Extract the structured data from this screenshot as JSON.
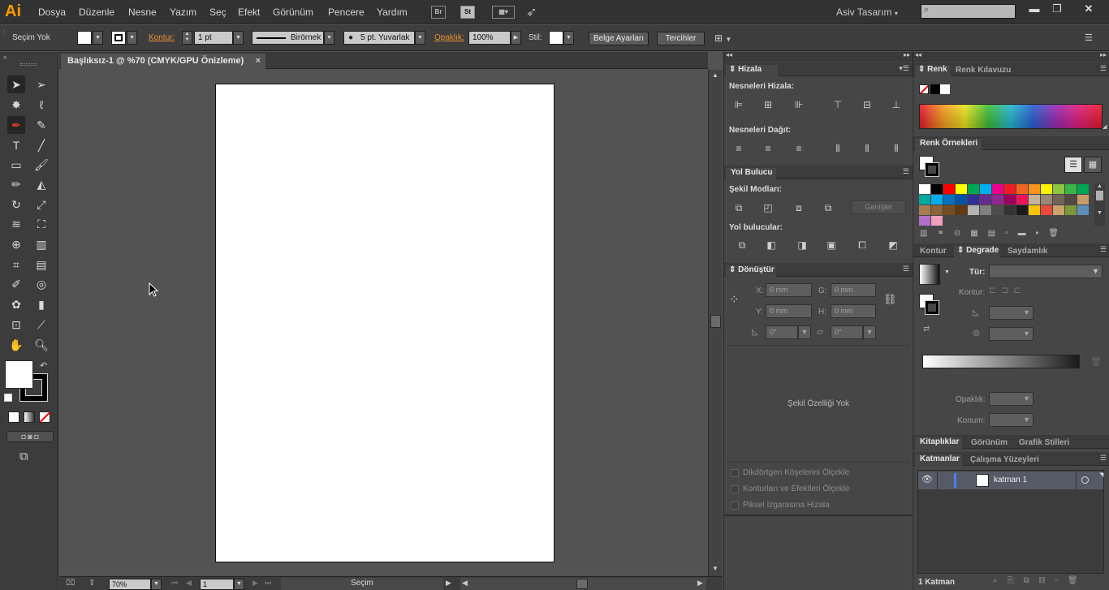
{
  "menubar": {
    "logo": "Ai",
    "items": [
      "Dosya",
      "Düzenle",
      "Nesne",
      "Yazım",
      "Seç",
      "Efekt",
      "Görünüm",
      "Pencere",
      "Yardım"
    ],
    "bridge": "Br",
    "stock": "St",
    "workspace": "Asiv Tasarım",
    "search_placeholder": ""
  },
  "control": {
    "selection": "Seçim Yok",
    "stroke_label": "Kontur:",
    "stroke_weight": "1 pt",
    "profile": "Birörnek",
    "brush": "5 pt. Yuvarlak",
    "opacity_label": "Opaklık:",
    "opacity": "100%",
    "style_label": "Stil:",
    "doc_setup": "Belge Ayarları",
    "prefs": "Tercihler"
  },
  "document": {
    "tab": "Başlıksız-1 @ %70 (CMYK/GPU Önizleme)",
    "close": "×",
    "zoom": "70%",
    "page": "1",
    "status": "Seçim"
  },
  "align": {
    "title": "Hizala",
    "align_objects": "Nesneleri Hizala:",
    "distribute_objects": "Nesneleri Dağıt:"
  },
  "pathfinder": {
    "title": "Yol Bulucu",
    "shape_modes": "Şekil Modları:",
    "expand": "Genişlet",
    "pathfinders": "Yol bulucular:"
  },
  "transform": {
    "title": "Dönüştür",
    "x_label": "X:",
    "x": "0 mm",
    "y_label": "Y:",
    "y": "0 mm",
    "g_label": "G:",
    "g": "0 mm",
    "h_label": "H:",
    "h": "0 mm",
    "angle": "0°",
    "shear": "0°",
    "no_shape": "Şekil Özelliği Yok",
    "opt1": "Dikdörtgen Köşelerini Ölçekle",
    "opt2": "Konturları ve Efektleri Ölçekle",
    "opt3": "Piksel Izgarasına Hizala"
  },
  "color": {
    "tab1": "Renk",
    "tab2": "Renk Kılavuzu",
    "swatches": "Renk Örnekleri",
    "swatch_colors": [
      "#ffffff",
      "#000000",
      "#ff0000",
      "#ffff00",
      "#00a651",
      "#00aeef",
      "#ec008c",
      "#ed1c24",
      "#f26522",
      "#f7941d",
      "#fff200",
      "#8dc63f",
      "#39b54a",
      "#00a651",
      "#00a99d",
      "#00aeef",
      "#0072bc",
      "#0054a6",
      "#2e3192",
      "#662d91",
      "#92278f",
      "#9e005d",
      "#ed145b",
      "#c7b299",
      "#998675",
      "#736357",
      "#534741",
      "#c69c6d",
      "#a67c52",
      "#8c6239",
      "#754c24",
      "#603913",
      "#b3b3b3",
      "#808080",
      "#4d4d4d",
      "#333333",
      "#1a1a1a",
      "#f5c400",
      "#e84c3d",
      "#cfa16b",
      "#7a9a3a",
      "#5e8fb8",
      "#b26fc9",
      "#f29fbe"
    ]
  },
  "gradient": {
    "tab1": "Kontur",
    "tab2": "Degrade",
    "tab3": "Saydamlık",
    "type_label": "Tür:",
    "stroke_label": "Kontur:",
    "opacity_label": "Opaklık:",
    "location_label": "Konum:"
  },
  "libraries": {
    "tab1": "Kitaplıklar",
    "tab2": "Görünüm",
    "tab3": "Grafik Stilleri"
  },
  "layers": {
    "tab1": "Katmanlar",
    "tab2": "Çalışma Yüzeyleri",
    "layer_name": "katman 1",
    "count": "1 Katman"
  }
}
